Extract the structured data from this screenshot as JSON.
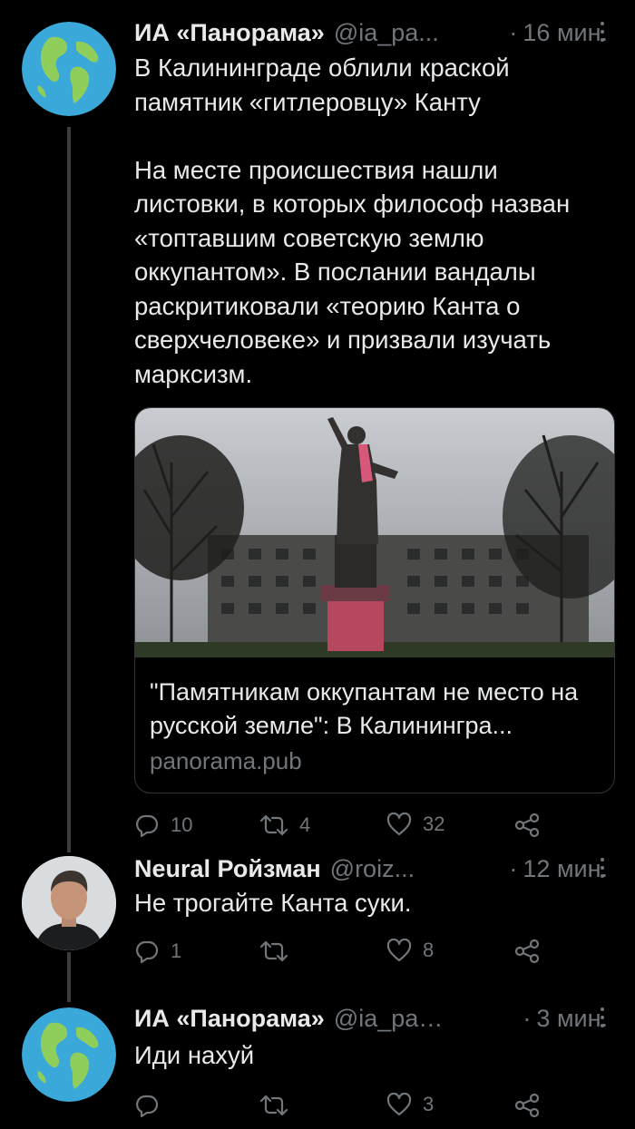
{
  "tweets": [
    {
      "name": "ИА «Панорама»",
      "handle": "@ia_pa...",
      "time": "16 мин.",
      "text": "В Калининграде облили краской\nпамятник «гитлеровцу» Канту\n\nНа месте происшествия нашли\nлистовки, в которых философ назван\n«топтавшим советскую землю\nоккупантом». В послании вандалы\nраскритиковали «теорию Канта о\nсверхчеловеке» и призвали изучать\nмарксизм.",
      "card": {
        "title": "\"Памятникам оккупантам не место на русской земле\": В Калинингра...",
        "domain": "panorama.pub"
      },
      "replies": "10",
      "retweets": "4",
      "likes": "32"
    },
    {
      "name": "Neural Ройзман",
      "handle": "@roiz...",
      "time": "12 мин.",
      "text": "Не трогайте Канта суки.",
      "replies": "1",
      "retweets": "",
      "likes": "8"
    },
    {
      "name": "ИА «Панорама»",
      "handle": "@ia_pan...",
      "time": "3 мин.",
      "text": "Иди нахуй",
      "replies": "",
      "retweets": "",
      "likes": "3"
    }
  ],
  "separator": "·",
  "colors": {
    "background": "#000000",
    "text": "#e7e9ea",
    "muted": "#71767b",
    "thread_line": "#3a3d40"
  }
}
